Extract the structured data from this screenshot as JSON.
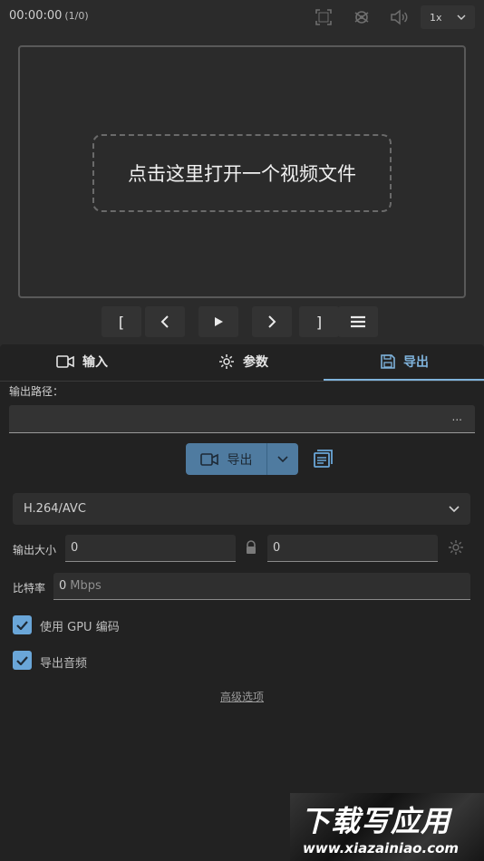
{
  "player": {
    "time": "00:00:00",
    "count": "(1/0)",
    "speed": "1x",
    "placeholder": "点击这里打开一个视频文件"
  },
  "controls": {
    "mark_in": "[",
    "mark_out": "]"
  },
  "tabs": [
    {
      "label": "输入",
      "icon": "video-camera-icon"
    },
    {
      "label": "参数",
      "icon": "gear-icon"
    },
    {
      "label": "导出",
      "icon": "floppy-disk-icon",
      "active": true
    }
  ],
  "export": {
    "path_label": "输出路径：",
    "path_value": "",
    "browse": "...",
    "button_label": "导出",
    "codec": "H.264/AVC",
    "size_label": "输出大小",
    "width": "0",
    "height": "0",
    "bitrate_label": "比特率",
    "bitrate_value": "0",
    "bitrate_unit": "Mbps",
    "gpu_label": "使用 GPU 编码",
    "gpu_checked": true,
    "audio_label": "导出音频",
    "audio_checked": true,
    "advanced": "高级选项"
  },
  "watermark": {
    "title": "下载写应用",
    "url": "www.xiazainiao.com"
  },
  "colors": {
    "accent": "#7fb3dc",
    "button": "#4f7ba0",
    "checkbox": "#6aa6d8",
    "background": "#2b2b2b",
    "panel": "#222222"
  }
}
